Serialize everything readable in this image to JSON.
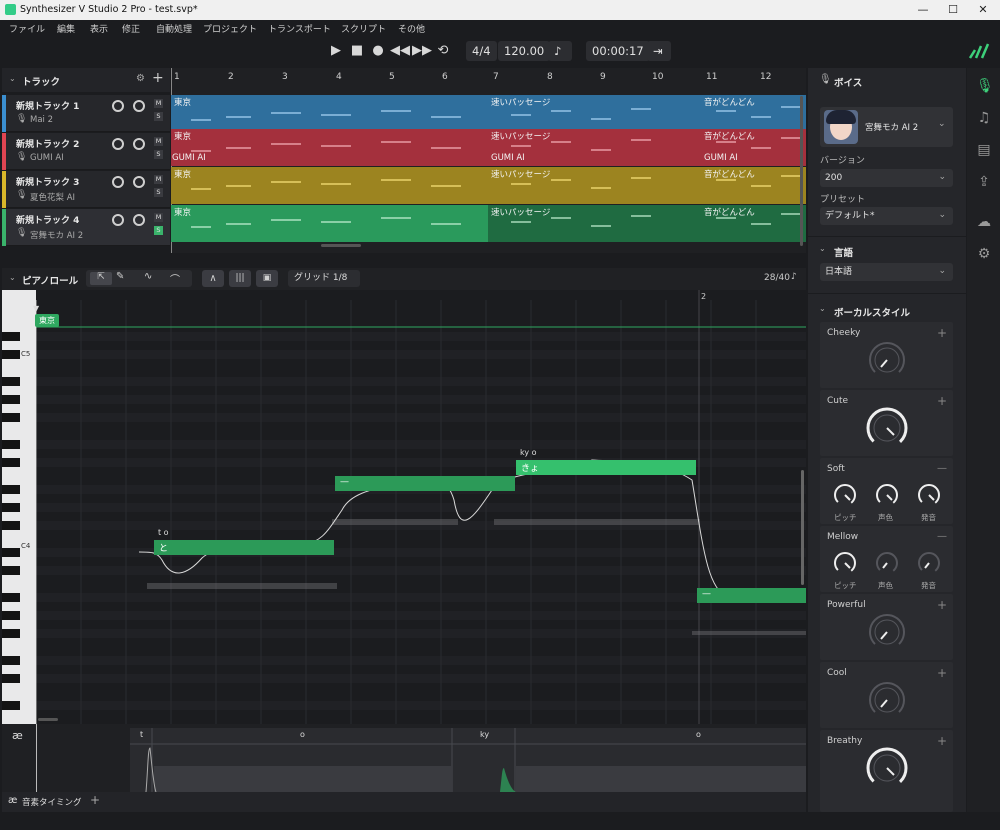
{
  "window": {
    "title": "Synthesizer V Studio 2 Pro - test.svp*"
  },
  "menu": [
    "ファイル",
    "編集",
    "表示",
    "修正",
    "自動処理",
    "プロジェクト",
    "トランスポート",
    "スクリプト",
    "その他"
  ],
  "transport": {
    "time_signature": "4/4",
    "tempo": "120.00",
    "position": "00:00:17"
  },
  "tracks_panel": {
    "title": "トラック"
  },
  "tracks": [
    {
      "name": "新規トラック 1",
      "voice": "Mai 2",
      "color": "#3b8fd0"
    },
    {
      "name": "新規トラック 2",
      "voice": "GUMI AI",
      "color": "#e04552"
    },
    {
      "name": "新規トラック 3",
      "voice": "夏色花梨 AI",
      "color": "#d9b72a"
    },
    {
      "name": "新規トラック 4",
      "voice": "宮舞モカ AI 2",
      "color": "#3ab36b"
    }
  ],
  "ruler": [
    "1",
    "2",
    "3",
    "4",
    "5",
    "6",
    "7",
    "8",
    "9",
    "10",
    "11",
    "12"
  ],
  "clips": {
    "c1": "東京",
    "c2": "速いパッセージ",
    "c3": "音がどんどん",
    "gumi": "GUMI AI"
  },
  "pianoroll": {
    "title": "ピアノロール",
    "grid": "グリッド 1/8",
    "counter": "28/40",
    "bar2": "2",
    "marker": "東京",
    "key_c5": "C5",
    "key_c4": "C4",
    "notes": [
      {
        "lyric": "と",
        "phoneme": "t o"
      },
      {
        "lyric": "—",
        "phoneme": ""
      },
      {
        "lyric": "きょ",
        "phoneme": "ky o"
      },
      {
        "lyric": "—",
        "phoneme": ""
      }
    ],
    "phonemes": [
      "t",
      "o",
      "ky",
      "o"
    ]
  },
  "status": {
    "ae": "æ",
    "label": "音素タイミング",
    "plus": "+"
  },
  "voice_panel": {
    "title": "ボイス",
    "voice_name": "宮舞モカ AI 2",
    "version_label": "バージョン",
    "version": "200",
    "preset_label": "プリセット",
    "preset": "デフォルト*",
    "language_title": "言語",
    "language": "日本語",
    "style_title": "ボーカルスタイル",
    "styles": [
      {
        "name": "Cheeky",
        "sign": "+"
      },
      {
        "name": "Cute",
        "sign": "+"
      },
      {
        "name": "Soft",
        "sign": "—",
        "sub": [
          "ピッチ",
          "声色",
          "発音"
        ]
      },
      {
        "name": "Mellow",
        "sign": "—",
        "sub": [
          "ピッチ",
          "声色",
          "発音"
        ]
      },
      {
        "name": "Powerful",
        "sign": "+"
      },
      {
        "name": "Cool",
        "sign": "+"
      },
      {
        "name": "Breathy",
        "sign": "+"
      }
    ]
  }
}
